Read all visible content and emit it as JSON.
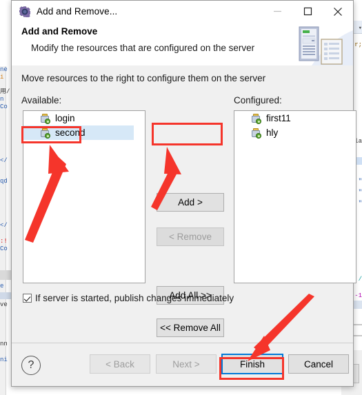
{
  "window": {
    "title": "Add and Remove...",
    "icon": "gear-icon",
    "minimize_label": "–",
    "maximize_label": "□",
    "close_label": "✕"
  },
  "header": {
    "title": "Add and Remove",
    "subtitle": "Modify the resources that are configured on the server",
    "banner_icon": "server-and-document-icon"
  },
  "body": {
    "instruction": "Move resources to the right to configure them on the server",
    "available_label": "Available:",
    "configured_label": "Configured:",
    "available_items": [
      {
        "label": "login",
        "icon": "web-module-icon",
        "selected": false
      },
      {
        "label": "second",
        "icon": "web-module-icon",
        "selected": true
      }
    ],
    "configured_items": [
      {
        "label": "first11",
        "icon": "web-module-icon",
        "selected": false
      },
      {
        "label": "hly",
        "icon": "web-module-icon",
        "selected": false
      }
    ],
    "buttons": {
      "add": "Add >",
      "remove": "< Remove",
      "add_all": "Add All >>",
      "remove_all": "<< Remove All"
    },
    "publish_checkbox": {
      "label": "If server is started, publish changes immediately",
      "checked": true
    }
  },
  "footer": {
    "help_label": "?",
    "back": "< Back",
    "next": "Next >",
    "finish": "Finish",
    "cancel": "Cancel"
  },
  "annotations": {
    "highlight_color": "#f5352b",
    "boxes": [
      "second-list-item",
      "add-button",
      "finish-button"
    ],
    "arrows": [
      "arrow-to-second-item",
      "arrow-to-add-button",
      "arrow-to-finish-button"
    ]
  },
  "background": {
    "left_fragments": [
      "ne",
      "i",
      "用/",
      "n",
      "Co",
      "</",
      "qd",
      "</",
      ":!",
      "Co",
      "e",
      "ve",
      "nn",
      "ni"
    ],
    "right_fragments": [
      "▾",
      "r;",
      "la",
      "\"",
      "\"",
      "\"",
      "/",
      "-1"
    ]
  }
}
